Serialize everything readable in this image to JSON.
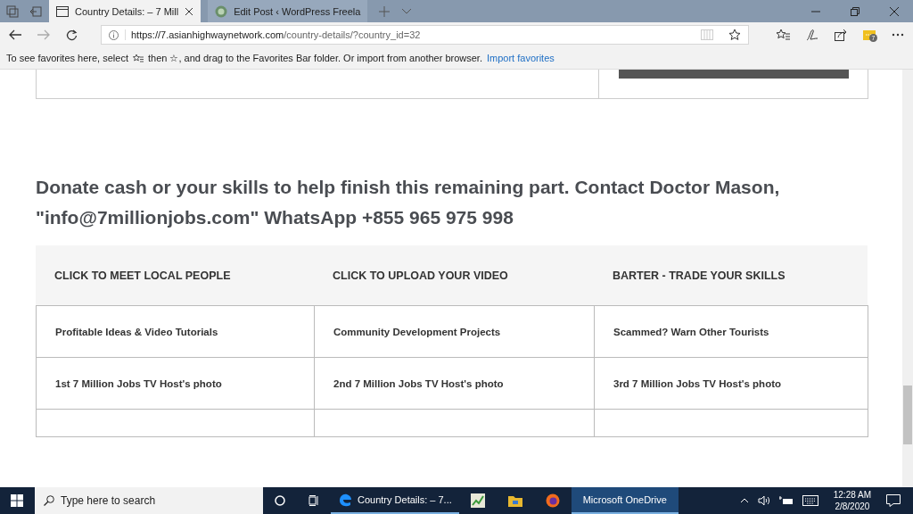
{
  "browser": {
    "tabs": [
      {
        "title": "Country Details: – 7 Mill",
        "selected": true,
        "kind": "page"
      },
      {
        "title": "Edit Post ‹ WordPress Freela",
        "selected": false,
        "kind": "site"
      }
    ],
    "address": {
      "host": "https://7.asianhighwaynetwork.com",
      "path": "/country-details/?country_id=32"
    },
    "extension_badge": "7",
    "favorites_bar": {
      "before": "To see favorites here, select",
      "middle": "then ☆, and drag to the Favorites Bar folder. Or import from another browser.",
      "link": "Import favorites"
    }
  },
  "page": {
    "heading": "Donate cash or your skills to help finish this remaining part. Contact Doctor Mason, \"info@7millionjobs.com\" WhatsApp +855 965 975 998",
    "table": {
      "columns": [
        "CLICK TO MEET LOCAL PEOPLE",
        "CLICK TO UPLOAD YOUR VIDEO",
        "BARTER - TRADE YOUR SKILLS"
      ],
      "rows": [
        [
          "Profitable Ideas & Video Tutorials",
          "Community Development Projects",
          "Scammed? Warn Other Tourists"
        ],
        [
          "1st 7 Million Jobs TV Host's photo",
          "2nd 7 Million Jobs TV Host's photo",
          "3rd 7 Million Jobs TV Host's photo"
        ],
        [
          "",
          "",
          ""
        ]
      ]
    }
  },
  "taskbar": {
    "search_placeholder": "Type here to search",
    "apps": [
      {
        "kind": "edge",
        "label": "Country Details: – 7...",
        "selected": true
      },
      {
        "kind": "chart"
      },
      {
        "kind": "folder"
      },
      {
        "kind": "firefox"
      },
      {
        "kind": "window",
        "label": "Microsoft OneDrive",
        "selected": true
      }
    ],
    "time": "12:28 AM",
    "date": "2/8/2020"
  }
}
